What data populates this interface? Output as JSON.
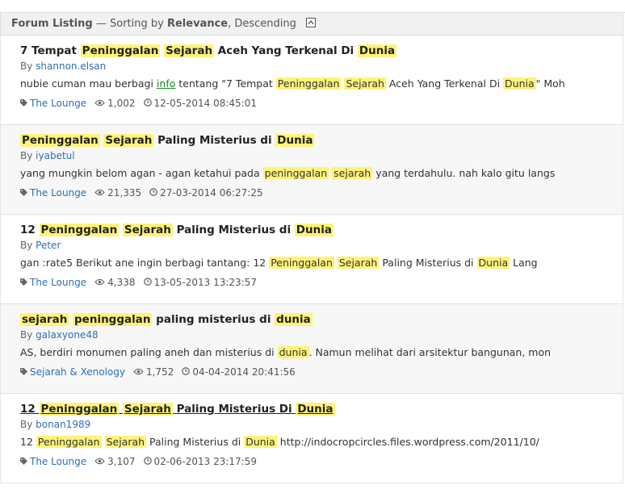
{
  "header": {
    "label_bold": "Forum Listing",
    "dash": " — Sorting by ",
    "sort_field": "Relevance",
    "sort_order": ", Descending"
  },
  "results": [
    {
      "title_parts": [
        {
          "t": "7 Tempat ",
          "hl": false
        },
        {
          "t": "Peninggalan",
          "hl": true
        },
        {
          "t": " ",
          "hl": false
        },
        {
          "t": "Sejarah",
          "hl": true
        },
        {
          "t": " Aceh Yang Terkenal Di ",
          "hl": false
        },
        {
          "t": "Dunia",
          "hl": true
        }
      ],
      "by_prefix": "By ",
      "author": "shannon.elsan",
      "snippet_parts": [
        {
          "t": "nubie cuman mau berbagi ",
          "hl": false
        },
        {
          "t": "info",
          "link": true
        },
        {
          "t": " tentang \"7 Tempat ",
          "hl": false
        },
        {
          "t": "Peninggalan",
          "hl": true
        },
        {
          "t": " ",
          "hl": false
        },
        {
          "t": "Sejarah",
          "hl": true
        },
        {
          "t": " Aceh Yang Terkenal Di ",
          "hl": false
        },
        {
          "t": "Dunia",
          "hl": true
        },
        {
          "t": "\" Moh",
          "hl": false
        }
      ],
      "forum": "The Lounge",
      "views": "1,002",
      "date": "12-05-2014 08:45:01",
      "underlined": false
    },
    {
      "title_parts": [
        {
          "t": "Peninggalan",
          "hl": true
        },
        {
          "t": " ",
          "hl": false
        },
        {
          "t": "Sejarah",
          "hl": true
        },
        {
          "t": " Paling Misterius di ",
          "hl": false
        },
        {
          "t": "Dunia",
          "hl": true
        }
      ],
      "by_prefix": "By ",
      "author": "iyabetul",
      "snippet_parts": [
        {
          "t": "yang mungkin belom agan - agan ketahui pada ",
          "hl": false
        },
        {
          "t": "peninggalan",
          "hl": true
        },
        {
          "t": " ",
          "hl": false
        },
        {
          "t": "sejarah",
          "hl": true
        },
        {
          "t": " yang terdahulu. nah kalo gitu langs",
          "hl": false
        }
      ],
      "forum": "The Lounge",
      "views": "21,335",
      "date": "27-03-2014 06:27:25",
      "underlined": false
    },
    {
      "title_parts": [
        {
          "t": "12 ",
          "hl": false
        },
        {
          "t": "Peninggalan",
          "hl": true
        },
        {
          "t": " ",
          "hl": false
        },
        {
          "t": "Sejarah",
          "hl": true
        },
        {
          "t": " Paling Misterius di ",
          "hl": false
        },
        {
          "t": "Dunia",
          "hl": true
        }
      ],
      "by_prefix": "By ",
      "author": "Peter",
      "snippet_parts": [
        {
          "t": "gan :rate5 Berikut ane ingin berbagi tantang: 12 ",
          "hl": false
        },
        {
          "t": "Peninggalan",
          "hl": true
        },
        {
          "t": " ",
          "hl": false
        },
        {
          "t": "Sejarah",
          "hl": true
        },
        {
          "t": " Paling Misterius di ",
          "hl": false
        },
        {
          "t": "Dunia",
          "hl": true
        },
        {
          "t": " Lang",
          "hl": false
        }
      ],
      "forum": "The Lounge",
      "views": "4,338",
      "date": "13-05-2013 13:23:57",
      "underlined": false
    },
    {
      "title_parts": [
        {
          "t": "sejarah",
          "hl": true
        },
        {
          "t": " ",
          "hl": false
        },
        {
          "t": "peninggalan",
          "hl": true
        },
        {
          "t": " paling misterius di ",
          "hl": false
        },
        {
          "t": "dunia",
          "hl": true
        }
      ],
      "by_prefix": "By ",
      "author": "galaxyone48",
      "snippet_parts": [
        {
          "t": "AS, berdiri monumen paling aneh dan misterius di ",
          "hl": false
        },
        {
          "t": "dunia",
          "hl": true
        },
        {
          "t": ". Namun melihat dari arsitektur bangunan, mon",
          "hl": false
        }
      ],
      "forum": "Sejarah & Xenology",
      "views": "1,752",
      "date": "04-04-2014 20:41:56",
      "underlined": false
    },
    {
      "title_parts": [
        {
          "t": "12 ",
          "hl": false
        },
        {
          "t": "Peninggalan",
          "hl": true
        },
        {
          "t": " ",
          "hl": false
        },
        {
          "t": "Sejarah",
          "hl": true
        },
        {
          "t": " Paling Misterius Di ",
          "hl": false
        },
        {
          "t": "Dunia",
          "hl": true
        }
      ],
      "by_prefix": "By ",
      "author": "bonan1989",
      "snippet_parts": [
        {
          "t": "12 ",
          "hl": false
        },
        {
          "t": "Peninggalan",
          "hl": true
        },
        {
          "t": " ",
          "hl": false
        },
        {
          "t": "Sejarah",
          "hl": true
        },
        {
          "t": " Paling Misterius di ",
          "hl": false
        },
        {
          "t": "Dunia",
          "hl": true
        },
        {
          "t": " http://indocropcircles.files.wordpress.com/2011/10/",
          "hl": false
        }
      ],
      "forum": "The Lounge",
      "views": "3,107",
      "date": "02-06-2013 23:17:59",
      "underlined": true
    }
  ],
  "colors": {
    "highlight": "#fff37a",
    "link": "#2f6eb5",
    "snippet_link": "#1f8a1f"
  },
  "icons": {
    "forum": "tag-icon",
    "views": "eye-icon",
    "date": "clock-icon",
    "collapse": "collapse-up-icon"
  }
}
